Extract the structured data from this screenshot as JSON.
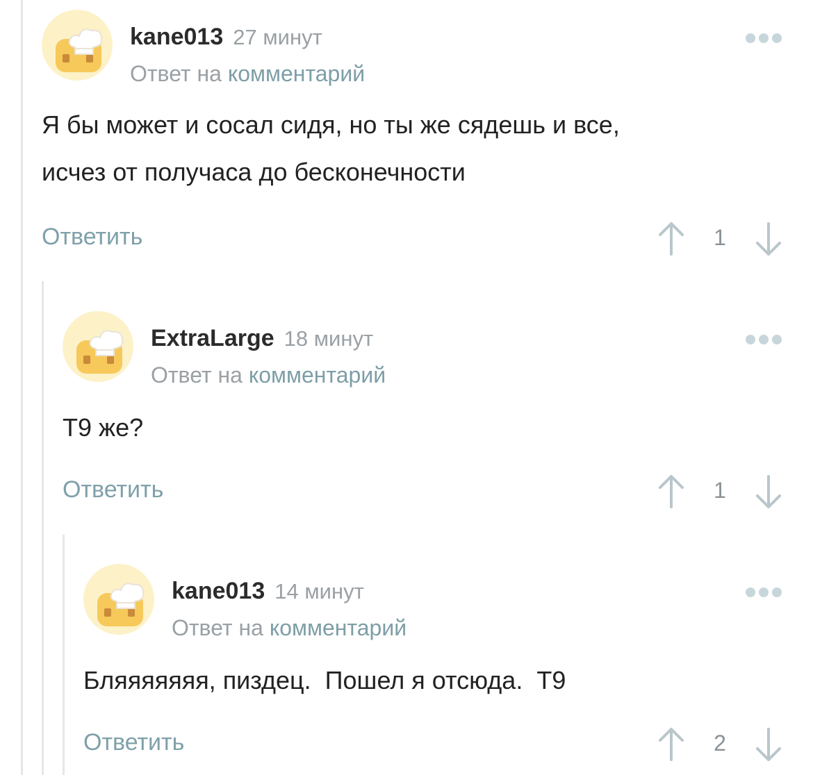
{
  "comments": [
    {
      "author": "kane013",
      "time": "27 минут",
      "reply_prefix": "Ответ на",
      "reply_link": "комментарий",
      "body": "Я бы может и сосал сидя, но ты же сядешь и все,\nисчез от получаса до бесконечности",
      "reply_label": "Ответить",
      "rating": "1"
    },
    {
      "author": "ExtraLarge",
      "time": "18 минут",
      "reply_prefix": "Ответ на",
      "reply_link": "комментарий",
      "body": "Т9 же?",
      "reply_label": "Ответить",
      "rating": "1"
    },
    {
      "author": "kane013",
      "time": "14 минут",
      "reply_prefix": "Ответ на",
      "reply_link": "комментарий",
      "body": "Бляяяяяяя, пиздец.  Пошел я отсюда.  Т9",
      "reply_label": "Ответить",
      "rating": "2"
    }
  ],
  "colors": {
    "thread_line": "#e4e7ea",
    "link": "#7e9ea7",
    "muted": "#9aa0a4",
    "dots": "#c7d6db",
    "avatar_bg": "#fdf1c8",
    "avatar_face": "#f6c95a"
  }
}
